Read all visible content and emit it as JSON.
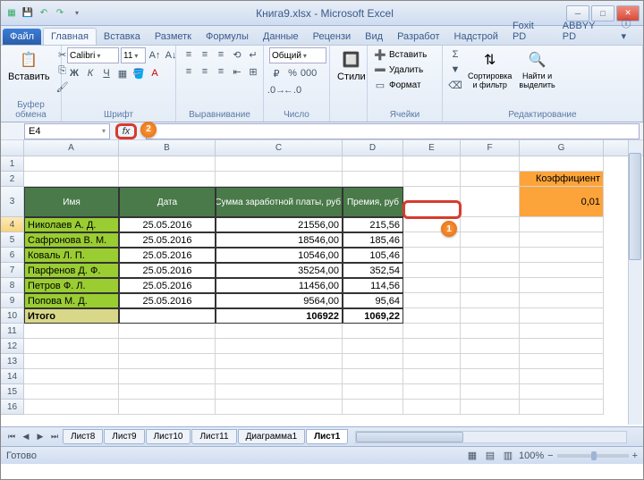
{
  "title": "Книга9.xlsx - Microsoft Excel",
  "qat": {
    "save": "💾",
    "undo": "↶",
    "redo": "↷"
  },
  "tabs": {
    "file": "Файл",
    "home": "Главная",
    "insert": "Вставка",
    "layout": "Разметк",
    "formulas": "Формулы",
    "data": "Данные",
    "review": "Рецензи",
    "view": "Вид",
    "dev": "Разработ",
    "addins": "Надстрой",
    "foxit": "Foxit PD",
    "abbyy": "ABBYY PD"
  },
  "ribbon": {
    "clipboard": {
      "paste": "Вставить",
      "label": "Буфер обмена"
    },
    "font": {
      "name": "Calibri",
      "size": "11",
      "label": "Шрифт"
    },
    "align": {
      "label": "Выравнивание"
    },
    "number": {
      "fmt": "Общий",
      "label": "Число"
    },
    "styles": {
      "btn": "Стили"
    },
    "cells": {
      "insert": "Вставить",
      "delete": "Удалить",
      "format": "Формат",
      "label": "Ячейки"
    },
    "editing": {
      "sort": "Сортировка\nи фильтр",
      "find": "Найти и\nвыделить",
      "label": "Редактирование"
    }
  },
  "namebox": "E4",
  "fx": "fx",
  "callout_fx": "2",
  "callout_cell": "1",
  "cols": [
    "A",
    "B",
    "C",
    "D",
    "E",
    "F",
    "G"
  ],
  "rownums": [
    "1",
    "2",
    "3",
    "4",
    "5",
    "6",
    "7",
    "8",
    "9",
    "10",
    "11",
    "12",
    "13",
    "14",
    "15",
    "16"
  ],
  "table": {
    "hdr": {
      "name": "Имя",
      "date": "Дата",
      "sum": "Сумма заработной платы, руб.",
      "bonus": "Премия, руб"
    },
    "coef_label": "Коэффициент",
    "coef_value": "0,01",
    "rows": [
      {
        "name": "Николаев А. Д.",
        "date": "25.05.2016",
        "sum": "21556,00",
        "bonus": "215,56"
      },
      {
        "name": "Сафронова В. М.",
        "date": "25.05.2016",
        "sum": "18546,00",
        "bonus": "185,46"
      },
      {
        "name": "Коваль Л. П.",
        "date": "25.05.2016",
        "sum": "10546,00",
        "bonus": "105,46"
      },
      {
        "name": "Парфенов Д. Ф.",
        "date": "25.05.2016",
        "sum": "35254,00",
        "bonus": "352,54"
      },
      {
        "name": "Петров Ф. Л.",
        "date": "25.05.2016",
        "sum": "11456,00",
        "bonus": "114,56"
      },
      {
        "name": "Попова М. Д.",
        "date": "25.05.2016",
        "sum": "9564,00",
        "bonus": "95,64"
      }
    ],
    "total": {
      "label": "Итого",
      "sum": "106922",
      "bonus": "1069,22"
    }
  },
  "sheets": [
    "Лист8",
    "Лист9",
    "Лист10",
    "Лист11",
    "Диаграмма1",
    "Лист1"
  ],
  "status": "Готово",
  "zoom": "100%"
}
